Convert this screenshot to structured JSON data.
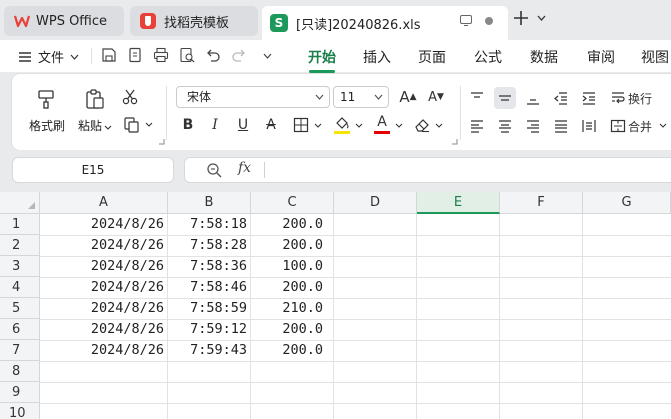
{
  "tabs": {
    "wps_label": "WPS Office",
    "daoke_label": "找稻壳模板",
    "file_label": "[只读]20240826.xls",
    "file_icon_letter": "S"
  },
  "menu": {
    "file_label": "文件",
    "tabs": [
      "开始",
      "插入",
      "页面",
      "公式",
      "数据",
      "审阅",
      "视图"
    ],
    "active_tab": "开始"
  },
  "ribbon": {
    "format_painter": "格式刷",
    "paste": "粘贴",
    "font_name": "宋体",
    "font_size": "11",
    "wrap_text": "换行",
    "merge": "合并",
    "bold": "B",
    "italic": "I",
    "underline": "U",
    "strikethrough": "A",
    "font_color_glyph": "A",
    "grow_font_glyph": "A",
    "shrink_font_glyph": "A",
    "highlight_color": "#f5e400",
    "font_color": "#e60000"
  },
  "formula_bar": {
    "cell_ref": "E15",
    "fx_label": "fx",
    "value": ""
  },
  "sheet": {
    "columns": [
      "A",
      "B",
      "C",
      "D",
      "E",
      "F",
      "G"
    ],
    "selected_column": "E",
    "row_numbers": [
      "1",
      "2",
      "3",
      "4",
      "5",
      "6",
      "7",
      "8",
      "9",
      "10"
    ],
    "rows": [
      [
        "2024/8/26",
        "7:58:18",
        "200.0"
      ],
      [
        "2024/8/26",
        "7:58:28",
        "200.0"
      ],
      [
        "2024/8/26",
        "7:58:36",
        "100.0"
      ],
      [
        "2024/8/26",
        "7:58:46",
        "200.0"
      ],
      [
        "2024/8/26",
        "7:58:59",
        "210.0"
      ],
      [
        "2024/8/26",
        "7:59:12",
        "200.0"
      ],
      [
        "2024/8/26",
        "7:59:43",
        "200.0"
      ]
    ]
  }
}
